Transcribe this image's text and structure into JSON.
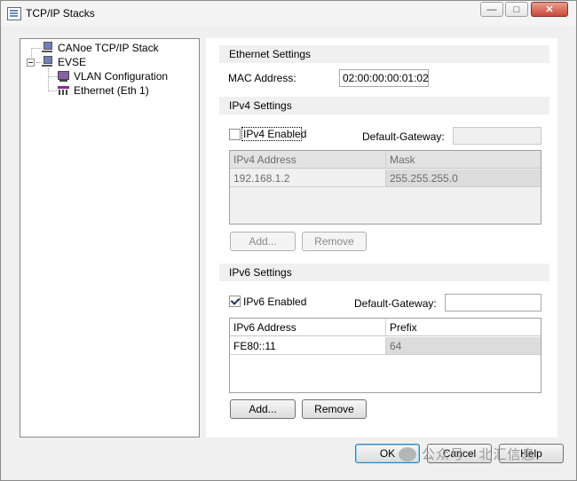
{
  "window": {
    "title": "TCP/IP Stacks",
    "min_glyph": "—",
    "max_glyph": "□",
    "close_glyph": "✕"
  },
  "tree": {
    "items": [
      {
        "label": "CANoe TCP/IP Stack",
        "icon": "network-computer-icon"
      },
      {
        "label": "EVSE",
        "icon": "network-computer-icon"
      },
      {
        "label": "VLAN Configuration",
        "icon": "vlan-icon"
      },
      {
        "label": "Ethernet (Eth 1)",
        "icon": "ethernet-icon"
      }
    ]
  },
  "ethernet": {
    "header": "Ethernet Settings",
    "mac_label": "MAC Address:",
    "mac_value": "02:00:00:00:01:02"
  },
  "ipv4": {
    "header": "IPv4 Settings",
    "enabled_label": "IPv4 Enabled",
    "enabled": false,
    "gateway_label": "Default-Gateway:",
    "gateway_value": "",
    "columns": [
      "IPv4 Address",
      "Mask"
    ],
    "rows": [
      [
        "192.168.1.2",
        "255.255.255.0"
      ]
    ],
    "add_label": "Add...",
    "remove_label": "Remove"
  },
  "ipv6": {
    "header": "IPv6 Settings",
    "enabled_label": "IPv6 Enabled",
    "enabled": true,
    "gateway_label": "Default-Gateway:",
    "gateway_value": "",
    "columns": [
      "IPv6 Address",
      "Prefix"
    ],
    "rows": [
      [
        "FE80::11",
        "64"
      ]
    ],
    "add_label": "Add...",
    "remove_label": "Remove"
  },
  "footer": {
    "ok_label": "OK",
    "cancel_label": "Cancel",
    "help_label": "Help"
  },
  "watermark": {
    "text": "公众号 · 北汇信息"
  }
}
